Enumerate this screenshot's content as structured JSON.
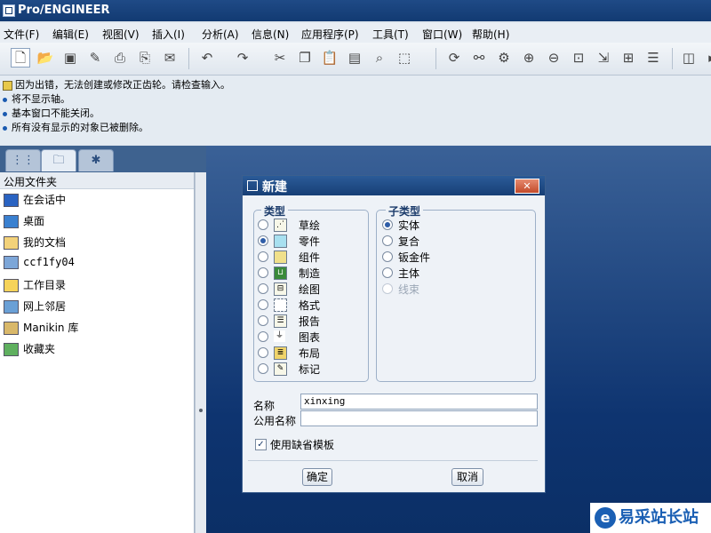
{
  "window": {
    "title": "Pro/ENGINEER"
  },
  "menubar": {
    "items": [
      "文件(F)",
      "编辑(E)",
      "视图(V)",
      "插入(I)",
      "分析(A)",
      "信息(N)",
      "应用程序(P)",
      "工具(T)",
      "窗口(W)",
      "帮助(H)"
    ]
  },
  "toolbar": {
    "icons": [
      "new-icon",
      "open-icon",
      "save-icon",
      "edit-icon",
      "print-icon",
      "send-icon",
      "email-icon",
      "undo-icon",
      "redo-icon",
      "cut-icon",
      "copy-icon",
      "paste-icon",
      "paste-special-icon",
      "find-icon",
      "select-box-icon",
      "regenerate-icon",
      "relations-icon",
      "model-tree-icon",
      "zoom-in-icon",
      "zoom-out-icon",
      "refit-icon",
      "orient-icon",
      "named-views-icon",
      "layers-icon",
      "3d-view-icon",
      "more-icon"
    ]
  },
  "messages": [
    {
      "text": "因为出错，无法创建或修改正齿轮。请检查输入。",
      "type": "warning"
    },
    {
      "text": "将不显示轴。",
      "type": "info"
    },
    {
      "text": "基本窗口不能关闭。",
      "type": "info"
    },
    {
      "text": "所有没有显示的对象已被删除。",
      "type": "info"
    }
  ],
  "navigator": {
    "header": "公用文件夹",
    "folders": [
      "在会话中",
      "桌面",
      "我的文档",
      "ccf1fy04",
      "工作目录",
      "网上邻居",
      "Manikin 库",
      "收藏夹"
    ]
  },
  "dialog": {
    "title": "新建",
    "close_label": "✕",
    "type_group": "类型",
    "types": [
      "草绘",
      "零件",
      "组件",
      "制造",
      "绘图",
      "格式",
      "报告",
      "图表",
      "布局",
      "标记"
    ],
    "type_selected": "零件",
    "subtype_group": "子类型",
    "subtypes": [
      "实体",
      "复合",
      "钣金件",
      "主体",
      "线束"
    ],
    "subtype_selected": "实体",
    "subtype_disabled": "线束",
    "name_label": "名称",
    "name_value": "xinxing",
    "common_name_label": "公用名称",
    "common_name_value": "",
    "use_default_label": "使用缺省模板",
    "use_default_checked": true,
    "ok_label": "确定",
    "cancel_label": "取消"
  },
  "watermark": {
    "text": "易采站长站"
  }
}
